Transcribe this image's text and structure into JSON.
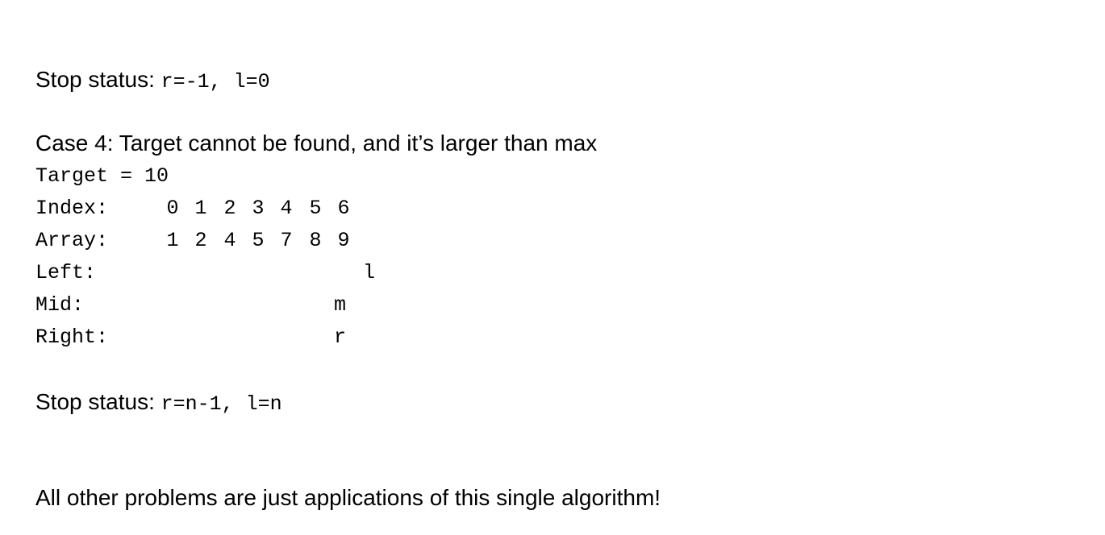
{
  "stop_status_1": {
    "label": "Stop status: ",
    "code": "r=-1, l=0"
  },
  "case4": {
    "heading": "Case 4: Target cannot be found, and it’s larger than max",
    "target_line": "Target = 10",
    "index_label": "Index:",
    "index_values": [
      "0",
      "1",
      "2",
      "3",
      "4",
      "5",
      "6"
    ],
    "array_label": "Array:",
    "array_values": [
      "1",
      "2",
      "4",
      "5",
      "7",
      "8",
      "9"
    ],
    "left_label": "Left:",
    "left_marker": "l",
    "mid_label": "Mid:",
    "mid_marker": "m",
    "right_label": "Right:",
    "right_marker": "r"
  },
  "stop_status_2": {
    "label": "Stop status: ",
    "code": "r=n-1, l=n"
  },
  "closing": "All other problems are just applications of this single algorithm!"
}
